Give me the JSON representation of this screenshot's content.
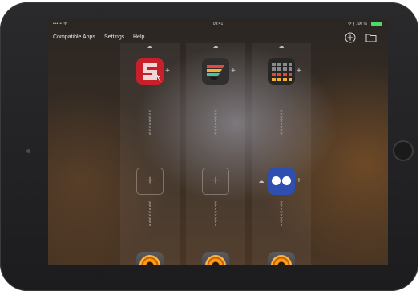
{
  "status_bar": {
    "carrier": "••••• ᯤ",
    "time": "09:41",
    "battery_percent": "⟳ ∦ 100 %"
  },
  "menu": {
    "items": [
      {
        "label": "Compatible Apps"
      },
      {
        "label": "Settings"
      },
      {
        "label": "Help"
      }
    ]
  },
  "toolbar": {
    "icons": [
      "add-circle-icon",
      "folder-icon"
    ]
  },
  "columns": [
    {
      "top_app": "red-s-synth-app-icon",
      "middle": "empty-slot",
      "bottom_app": "orange-speaker-app-icon",
      "plus_symbol": "+"
    },
    {
      "top_app": "color-stripes-app-icon",
      "middle": "empty-slot",
      "bottom_app": "orange-speaker-app-icon",
      "plus_symbol": "+"
    },
    {
      "top_app": "drum-pad-app-icon",
      "middle": "blue-dots-app-icon",
      "bottom_app": "orange-speaker-app-icon",
      "plus_symbol": "+"
    }
  ],
  "symbols": {
    "plus": "+",
    "cloud": "☁",
    "chevrons": "˅\n˅\n˅\n˅\n˅\n˅\n˅\n˅"
  },
  "colors": {
    "accent_blue": "#2e4fb0",
    "speaker_orange": "#ff9a1a",
    "battery_green": "#4cd964"
  }
}
